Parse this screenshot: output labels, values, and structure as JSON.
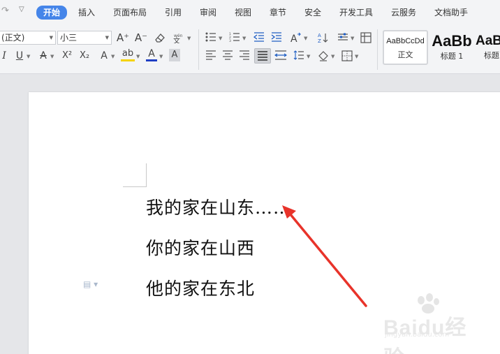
{
  "quick_access": {
    "redo_icon": "redo-icon",
    "more_icon": "chevron-down-icon"
  },
  "tabs": [
    {
      "label": "开始",
      "active": true
    },
    {
      "label": "插入"
    },
    {
      "label": "页面布局"
    },
    {
      "label": "引用"
    },
    {
      "label": "审阅"
    },
    {
      "label": "视图"
    },
    {
      "label": "章节"
    },
    {
      "label": "安全"
    },
    {
      "label": "开发工具"
    },
    {
      "label": "云服务"
    },
    {
      "label": "文档助手"
    }
  ],
  "ribbon": {
    "font_name": "(正文)",
    "font_size": "小三",
    "grow_font": "A⁺",
    "shrink_font": "A⁻",
    "italic": "I",
    "underline": "U",
    "strike": "A",
    "superscript": "X²",
    "subscript": "X₂",
    "text_effect": "A",
    "highlight": "ab",
    "font_color": "A",
    "char_shading": "A",
    "highlight_color": "#f5d300",
    "font_color_value": "#c00000",
    "styles": [
      {
        "preview": "AaBbCcDd",
        "name": "正文"
      },
      {
        "preview": "AaBb",
        "name": "标题 1"
      },
      {
        "preview": "AaBl",
        "name": "标题"
      }
    ]
  },
  "document": {
    "lines": [
      "我的家在山东……",
      "你的家在山西",
      "他的家在东北"
    ]
  },
  "annotation": {
    "arrow_color": "#e8332a"
  },
  "watermark": {
    "brand": "Baidu经验",
    "url": "jingyan.baidu.com"
  }
}
